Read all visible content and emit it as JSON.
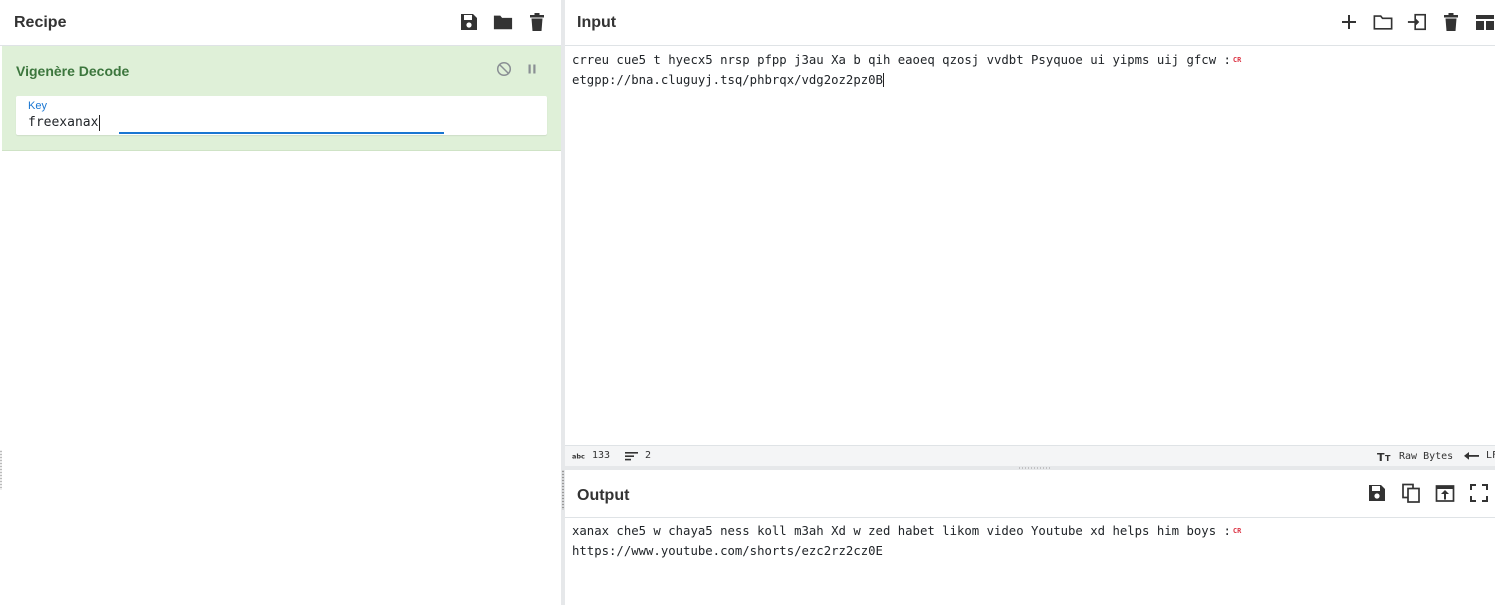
{
  "recipe": {
    "title": "Recipe",
    "icons": [
      "save-icon",
      "folder-icon",
      "trash-icon"
    ],
    "operation": {
      "name": "Vigenère Decode",
      "key_label": "Key",
      "key_value": "freexanax"
    }
  },
  "input": {
    "title": "Input",
    "line1": "crreu cue5 t hyecx5 nrsp pfpp j3au Xa b qih eaoeq qzosj vvdbt Psyquoe ui yipms uij gfcw :",
    "line2": "etgpp://bna.cluguyj.tsq/phbrqx/vdg2oz2pz0B",
    "cr_marker": "CR",
    "icons": [
      "plus-icon",
      "folder-icon",
      "import-icon",
      "trash-icon",
      "layout-icon"
    ]
  },
  "status": {
    "char_count": "133",
    "line_count": "2",
    "encoding": "Raw Bytes",
    "eol": "LF"
  },
  "output": {
    "title": "Output",
    "line1": "xanax che5 w chaya5 ness koll m3ah Xd w zed habet likom video Youtube xd helps him boys :",
    "line2": "https://www.youtube.com/shorts/ezc2rz2cz0E",
    "cr_marker": "CR",
    "icons": [
      "save-icon",
      "copy-icon",
      "export-icon",
      "fullscreen-icon"
    ]
  }
}
